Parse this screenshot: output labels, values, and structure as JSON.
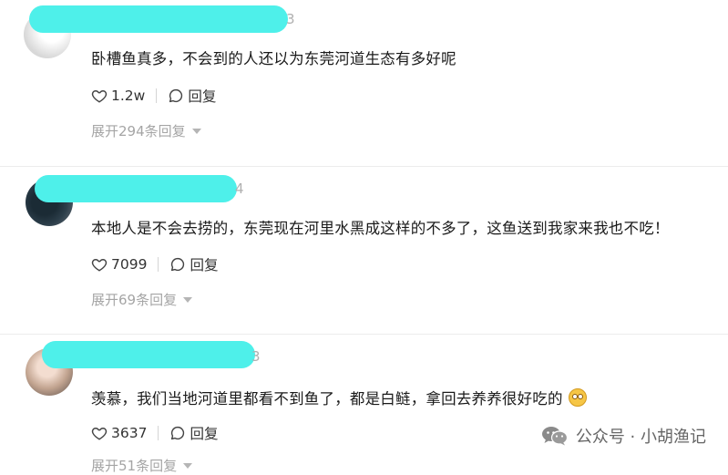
{
  "comments": [
    {
      "name_tail": "3",
      "text": "卧槽鱼真多，不会到的人还以为东莞河道生态有多好呢",
      "likes": "1.2w",
      "reply_label": "回复",
      "expand_label": "展开294条回复"
    },
    {
      "name_tail": "4",
      "text": "本地人是不会去捞的，东莞现在河里水黑成这样的不多了，这鱼送到我家来我也不吃！",
      "likes": "7099",
      "reply_label": "回复",
      "expand_label": "展开69条回复"
    },
    {
      "name_tail": "3",
      "text": "羡慕，我们当地河道里都看不到鱼了，都是白鲢，拿回去养养很好吃的",
      "likes": "3637",
      "reply_label": "回复",
      "expand_label": "展开51条回复"
    }
  ],
  "watermark": {
    "label": "公众号 · 小胡渔记"
  },
  "icons": [
    "heart-icon",
    "reply-bubble-icon",
    "chevron-down-icon",
    "wechat-icon",
    "drooling-emoji-icon"
  ]
}
